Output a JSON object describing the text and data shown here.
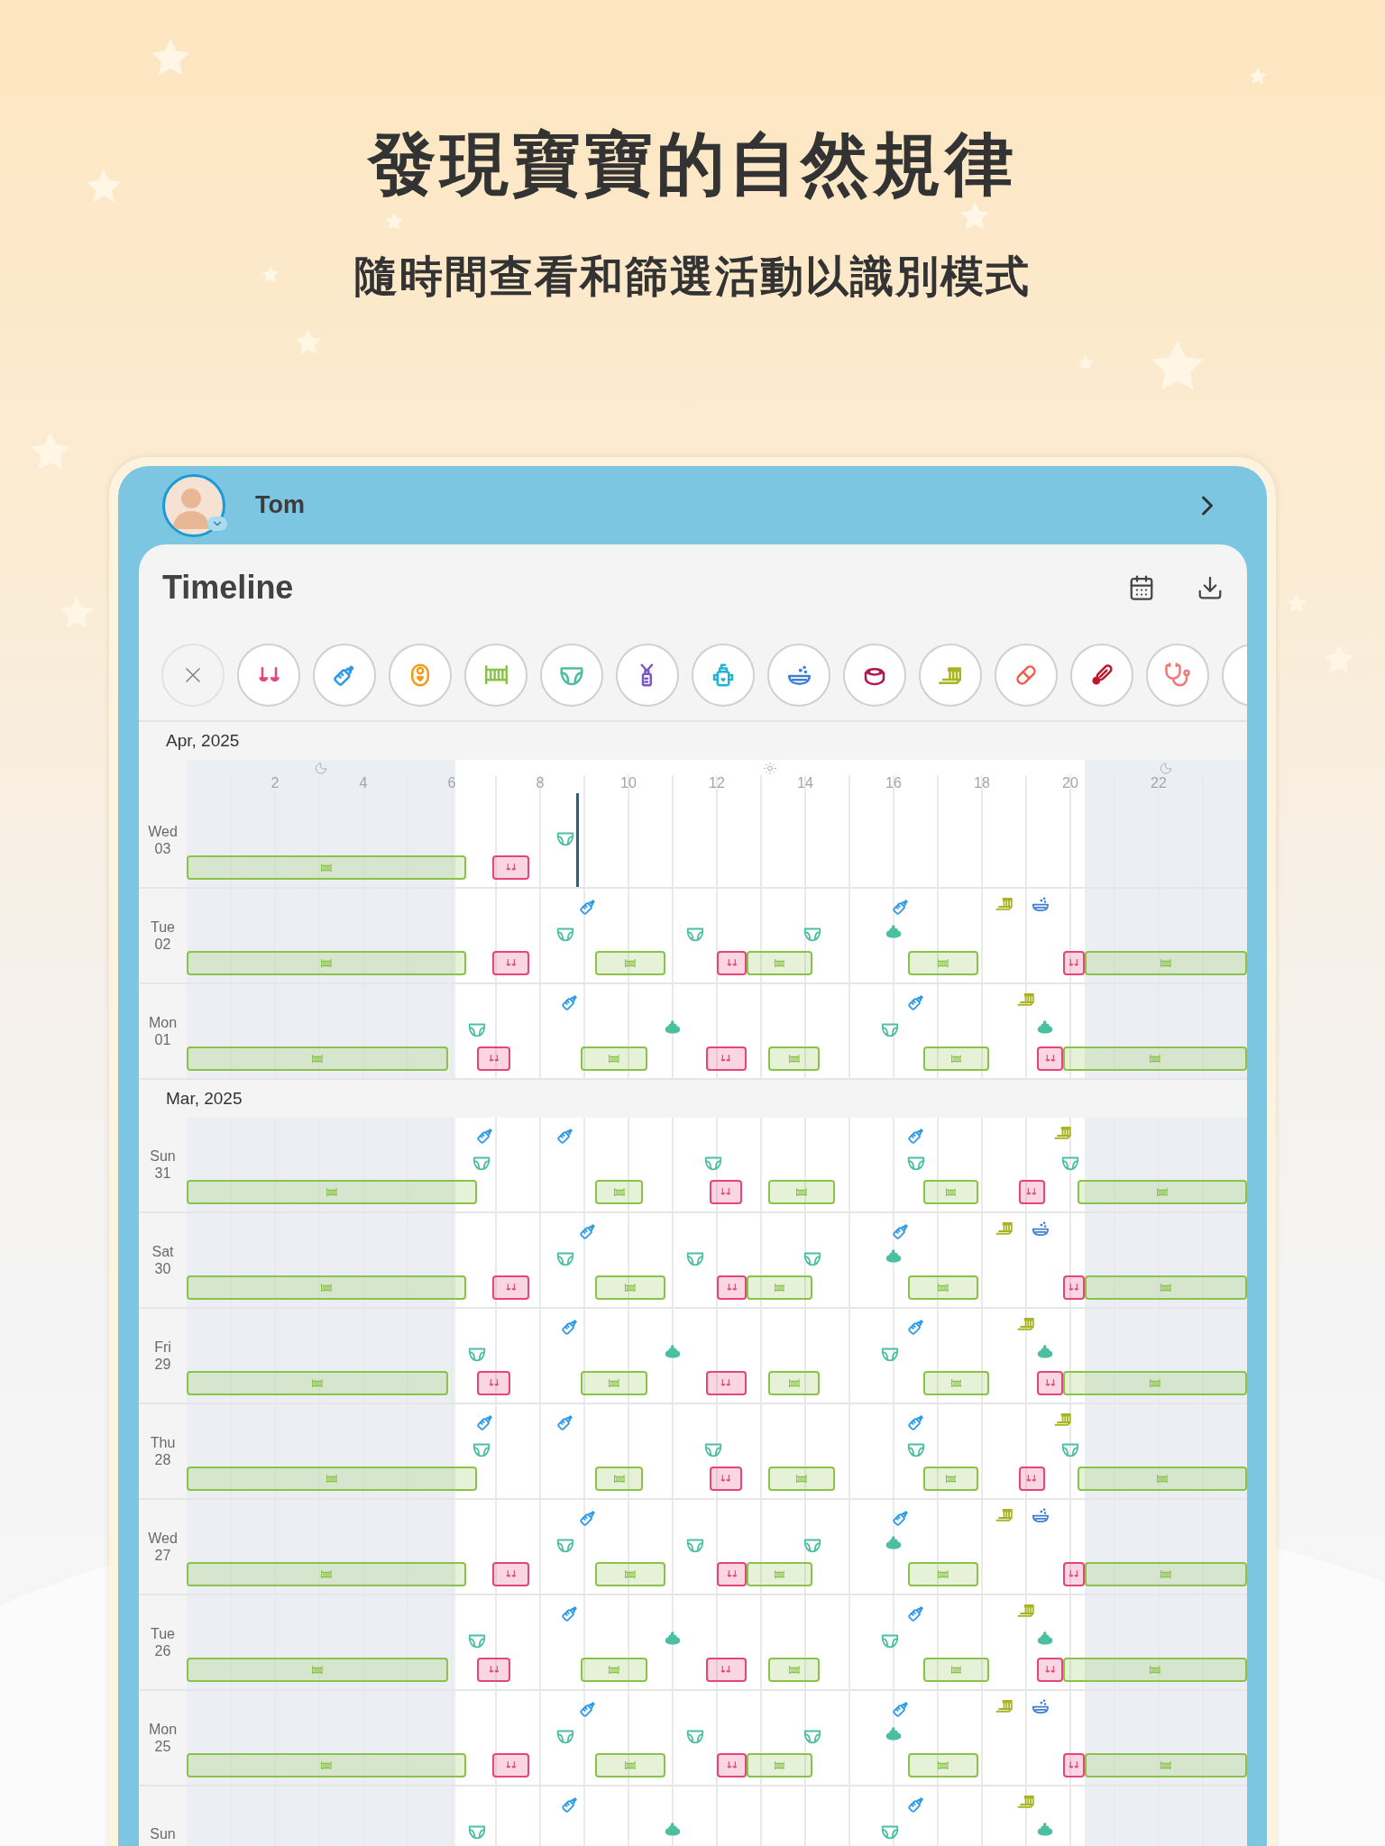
{
  "headline": "發現寶寶的自然規律",
  "subheadline": "隨時間查看和篩選活動以識別模式",
  "profile": {
    "name": "Tom"
  },
  "screen": {
    "title": "Timeline"
  },
  "filters": [
    {
      "kind": "clear",
      "color": "#8a8a8a"
    },
    {
      "kind": "nursing",
      "color": "#e5457a"
    },
    {
      "kind": "bottle",
      "color": "#2e9be8"
    },
    {
      "kind": "solids",
      "color": "#f29b16"
    },
    {
      "kind": "sleep",
      "color": "#8bc34a"
    },
    {
      "kind": "diaper",
      "color": "#4cbfa0"
    },
    {
      "kind": "pump",
      "color": "#7b57c4"
    },
    {
      "kind": "drink",
      "color": "#1fb3d6"
    },
    {
      "kind": "bath",
      "color": "#3f7fd6"
    },
    {
      "kind": "potty",
      "color": "#b0184f"
    },
    {
      "kind": "teeth",
      "color": "#a8b422"
    },
    {
      "kind": "medicine",
      "color": "#f25a4a"
    },
    {
      "kind": "temperature",
      "color": "#c0162c"
    },
    {
      "kind": "doctor",
      "color": "#ef7a7a"
    },
    {
      "kind": "more"
    }
  ],
  "timeline": {
    "hours": [
      "2",
      "4",
      "6",
      "8",
      "10",
      "12",
      "14",
      "16",
      "18",
      "20",
      "22"
    ],
    "months": [
      {
        "label": "Apr, 2025",
        "days": [
          {
            "weekday": "Wed",
            "date": "03"
          },
          {
            "weekday": "Tue",
            "date": "02"
          },
          {
            "weekday": "Mon",
            "date": "01"
          }
        ]
      },
      {
        "label": "Mar, 2025",
        "days": [
          {
            "weekday": "Sun",
            "date": "31"
          },
          {
            "weekday": "Sat",
            "date": "30"
          },
          {
            "weekday": "Fri",
            "date": "29"
          },
          {
            "weekday": "Thu",
            "date": "28"
          },
          {
            "weekday": "Wed",
            "date": "27"
          },
          {
            "weekday": "Tue",
            "date": "26"
          },
          {
            "weekday": "Mon",
            "date": "25"
          },
          {
            "weekday": "Sun"
          }
        ]
      }
    ]
  }
}
